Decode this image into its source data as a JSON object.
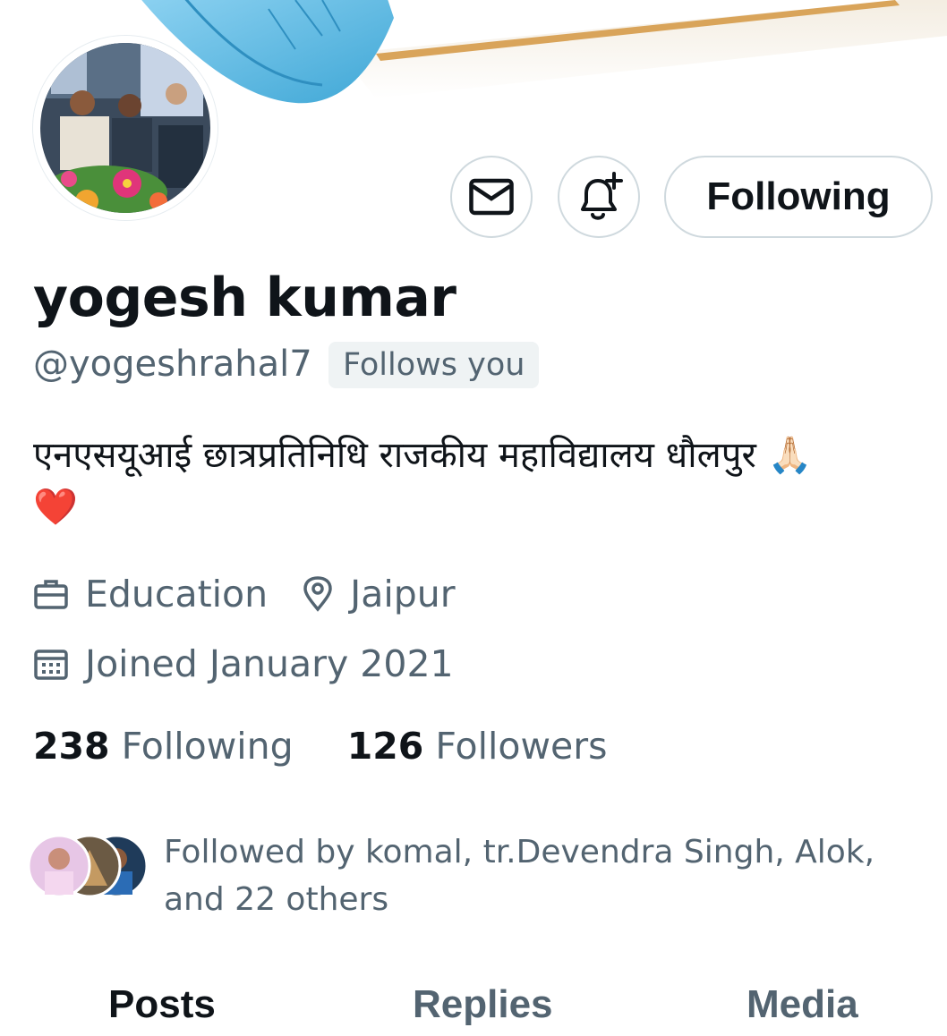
{
  "profile": {
    "name": "yogesh kumar",
    "handle": "@yogeshrahal7",
    "follows_you_badge": "Follows you",
    "bio_text": "एनएसयूआई छात्रप्रतिनिधि राजकीय महाविद्यालय धौलपुर 🙏🏻",
    "bio_emoji": "❤️",
    "category": "Education",
    "location": "Jaipur",
    "joined": "Joined January 2021"
  },
  "actions": {
    "message_icon": "mail-icon",
    "notify_icon": "bell-plus-icon",
    "follow_button_label": "Following"
  },
  "stats": {
    "following_count": "238",
    "following_label": "Following",
    "followers_count": "126",
    "followers_label": "Followers"
  },
  "followed_by": {
    "line1": "Followed by komal, tr.Devendra Singh, Alok,",
    "line2": "and 22 others"
  },
  "tabs": [
    {
      "label": "Posts",
      "active": true
    },
    {
      "label": "Replies",
      "active": false
    },
    {
      "label": "Media",
      "active": false
    }
  ],
  "colors": {
    "text_primary": "#0f1419",
    "text_secondary": "#536471",
    "border": "#cfd9de",
    "badge_bg": "#eff3f4",
    "banner_feather": "#5ab4dd"
  }
}
